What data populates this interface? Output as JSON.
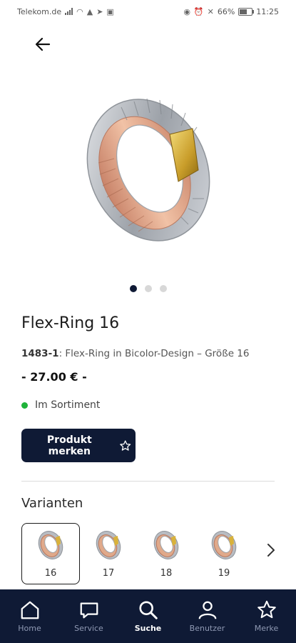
{
  "status_bar": {
    "carrier": "Telekom.de",
    "battery": "66%",
    "battery_level": 0.66,
    "time": "11:25"
  },
  "product": {
    "title": "Flex-Ring 16",
    "sku": "1483-1",
    "description": ": Flex-Ring in Bicolor-Design – Größe 16",
    "price": "- 27.00 € -",
    "availability": "Im Sortiment",
    "image_count": 3,
    "active_image_index": 0
  },
  "actions": {
    "remember_label": "Produkt merken"
  },
  "variants": {
    "title": "Varianten",
    "items": [
      {
        "label": "16",
        "selected": true
      },
      {
        "label": "17",
        "selected": false
      },
      {
        "label": "18",
        "selected": false
      },
      {
        "label": "19",
        "selected": false
      }
    ]
  },
  "nav": {
    "items": [
      {
        "label": "Home",
        "icon": "home-icon",
        "active": false
      },
      {
        "label": "Service",
        "icon": "chat-icon",
        "active": false
      },
      {
        "label": "Suche",
        "icon": "search-icon",
        "active": true
      },
      {
        "label": "Benutzer",
        "icon": "user-icon",
        "active": false
      },
      {
        "label": "Merke",
        "icon": "star-icon",
        "active": false
      }
    ]
  },
  "colors": {
    "brand_navy": "#0f1a35",
    "availability_green": "#1fb33a",
    "gold": "#d9b23a",
    "rose": "#e0a98a",
    "silver": "#b8bcc2"
  }
}
